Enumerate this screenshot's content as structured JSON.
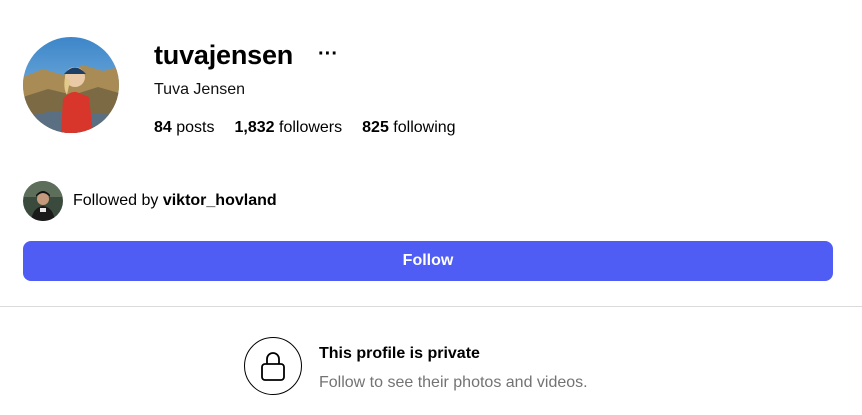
{
  "profile": {
    "username": "tuvajensen",
    "full_name": "Tuva Jensen",
    "more_icon": "more-horizontal-icon",
    "stats": {
      "posts_count": "84",
      "posts_label": "posts",
      "followers_count": "1,832",
      "followers_label": "followers",
      "following_count": "825",
      "following_label": "following"
    }
  },
  "followed_by": {
    "prefix": "Followed by",
    "user": "viktor_hovland"
  },
  "actions": {
    "follow_label": "Follow",
    "accent_color": "#4f5df5"
  },
  "private": {
    "icon": "lock-icon",
    "title": "This profile is private",
    "subtitle": "Follow to see their photos and videos."
  }
}
